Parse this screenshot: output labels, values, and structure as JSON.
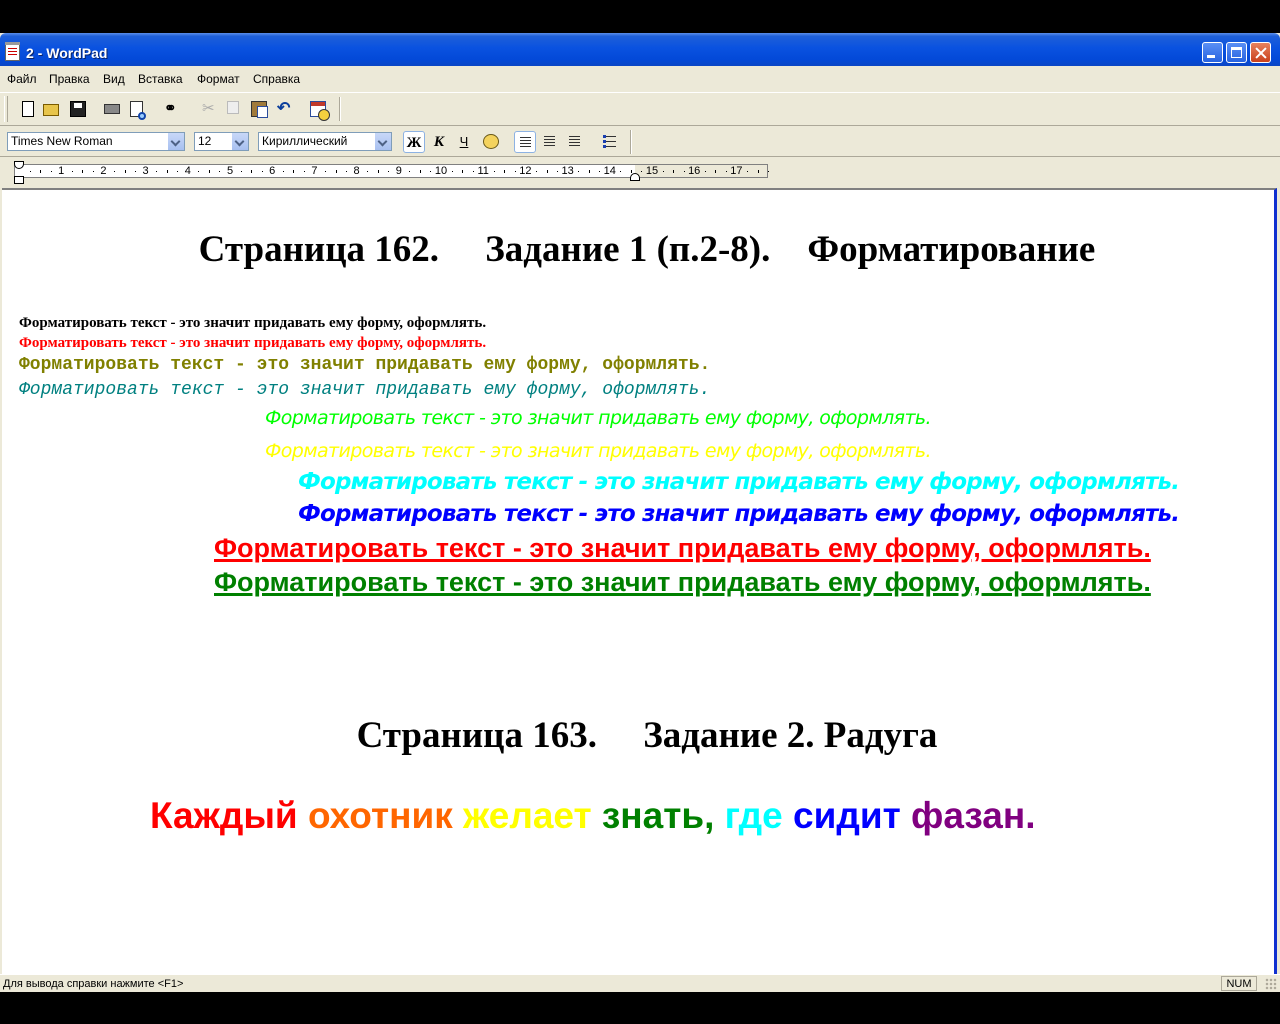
{
  "window": {
    "title": "2 - WordPad",
    "controls": {
      "minimize": "minimize",
      "maximize": "maximize",
      "close": "close"
    }
  },
  "menu": [
    "Файл",
    "Правка",
    "Вид",
    "Вставка",
    "Формат",
    "Справка"
  ],
  "toolbar": {
    "icons": [
      "new-document-icon",
      "open-folder-icon",
      "save-icon",
      "print-icon",
      "print-preview-icon",
      "find-icon",
      "cut-icon",
      "copy-icon",
      "paste-icon",
      "undo-icon",
      "insert-date-time-icon"
    ],
    "find_glyph": "⚭",
    "cut_glyph": "✂",
    "undo_glyph": "↶"
  },
  "format_bar": {
    "font": "Times New Roman",
    "size": "12",
    "script": "Кириллический",
    "bold": "Ж",
    "italic": "К",
    "underline": "Ч",
    "bold_pressed": true,
    "align_left_pressed": true
  },
  "ruler": {
    "numbers": [
      "1",
      "2",
      "3",
      "4",
      "5",
      "6",
      "7",
      "8",
      "9",
      "10",
      "11",
      "12",
      "13",
      "14",
      "15",
      "16",
      "17"
    ],
    "unit": "cm"
  },
  "document": {
    "heading1": "Страница 162.     Задание 1 (п.2-8).    Форматирование",
    "sample_text": "Форматировать текст - это значит придавать ему форму, оформлять.",
    "lines": [
      {
        "color": "#000000",
        "style": "serif-bold-condensed"
      },
      {
        "color": "#ff0000",
        "style": "serif-bold-condensed"
      },
      {
        "color": "#808000",
        "style": "mono-bold"
      },
      {
        "color": "#008080",
        "style": "mono-italic"
      },
      {
        "color": "#00ff00",
        "style": "sans-italic"
      },
      {
        "color": "#ffff00",
        "style": "sans-italic"
      },
      {
        "color": "#00ffff",
        "style": "sans-bold-italic"
      },
      {
        "color": "#0000ff",
        "style": "sans-bold-italic"
      },
      {
        "color": "#ff0000",
        "style": "sans-bold-underline"
      },
      {
        "color": "#008000",
        "style": "sans-bold-underline"
      }
    ],
    "heading2": "Страница 163.     Задание 2. Радуга",
    "rainbow": [
      {
        "word": "Каждый",
        "color": "#ff0000"
      },
      {
        "word": "охотник",
        "color": "#ff6600"
      },
      {
        "word": "желает",
        "color": "#ffff00"
      },
      {
        "word": "знать,",
        "color": "#008000"
      },
      {
        "word": "где",
        "color": "#00ffff"
      },
      {
        "word": "сидит",
        "color": "#0000ff"
      },
      {
        "word": "фазан.",
        "color": "#800080"
      }
    ]
  },
  "status": {
    "help_text": "Для вывода справки нажмите <F1>",
    "num_indicator": "NUM"
  }
}
